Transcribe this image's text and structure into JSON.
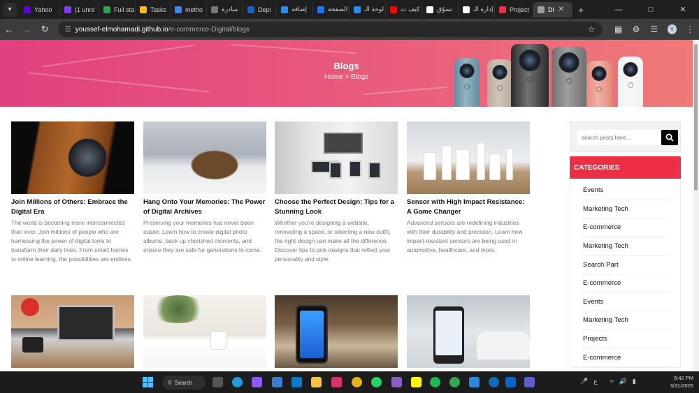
{
  "browser": {
    "tabs": [
      {
        "label": "Yahoo",
        "color": "#6001d2"
      },
      {
        "label": "(1 unre",
        "color": "#7d3cff"
      },
      {
        "label": "Full sta",
        "color": "#2ea44f"
      },
      {
        "label": "Tasks",
        "color": "#fbbc05"
      },
      {
        "label": "metho",
        "color": "#4285f4"
      },
      {
        "label": "مبادرة",
        "color": "#777777"
      },
      {
        "label": "Depi",
        "color": "#1565c0"
      },
      {
        "label": "إضافة",
        "color": "#2a8bf2"
      },
      {
        "label": "الصفحة",
        "color": "#1877f2"
      },
      {
        "label": "لوحة الـ",
        "color": "#2a8bf2"
      },
      {
        "label": "كيف ت",
        "color": "#ff0000"
      },
      {
        "label": "تسوّق",
        "color": "#ffffff"
      },
      {
        "label": "إدارة الـ",
        "color": "#ffffff"
      },
      {
        "label": "Project",
        "color": "#ee2f43"
      },
      {
        "label": "Di",
        "color": "#9aa0a6"
      }
    ],
    "url_host": "youssef-elmohamadi.github.io",
    "url_path": "/e-commerce-Digital/blogs",
    "profile_initial": "Y"
  },
  "hero": {
    "title": "Blogs",
    "breadcrumb": "Home > Blogs",
    "camera_colors": [
      "#5f8ea3",
      "#b9a99a",
      "#2c2c2c",
      "#6f6f6f",
      "#e58b7b",
      "#f2f2f2"
    ]
  },
  "posts": [
    {
      "title": "Join Millions of Others: Embrace the Digital Era",
      "excerpt": "The world is becoming more interconnected than ever. Join millions of people who are harnessing the power of digital tools to transform their daily lives. From smart homes to online learning, the possibilities are endless."
    },
    {
      "title": "Hang Onto Your Memories: The Power of Digital Archives",
      "excerpt": "Preserving your memories has never been easier. Learn how to create digital photo albums, back up cherished moments, and ensure they are safe for generations to come."
    },
    {
      "title": "Choose the Perfect Design: Tips for a Stunning Look",
      "excerpt": "Whether you're designing a website, renovating a space, or selecting a new outfit, the right design can make all the difference. Discover tips to pick designs that reflect your personality and style."
    },
    {
      "title": "Sensor with High Impact Resistance: A Game Changer",
      "excerpt": "Advanced sensors are redefining industries with their durability and precision. Learn how impact-resistant sensors are being used in automotive, healthcare, and more."
    }
  ],
  "sidebar": {
    "search_placeholder": "search posts here...",
    "categories_title": "CATEGORIES",
    "categories": [
      "Events",
      "Marketing Tech",
      "E-commerce",
      "Marketing Tech",
      "Search Part",
      "E-commerce",
      "Events",
      "Marketing Tech",
      "Projects",
      "E-commerce"
    ]
  },
  "taskbar": {
    "search_label": "Search",
    "time": "8:42 PM",
    "date": "3/31/2026"
  }
}
